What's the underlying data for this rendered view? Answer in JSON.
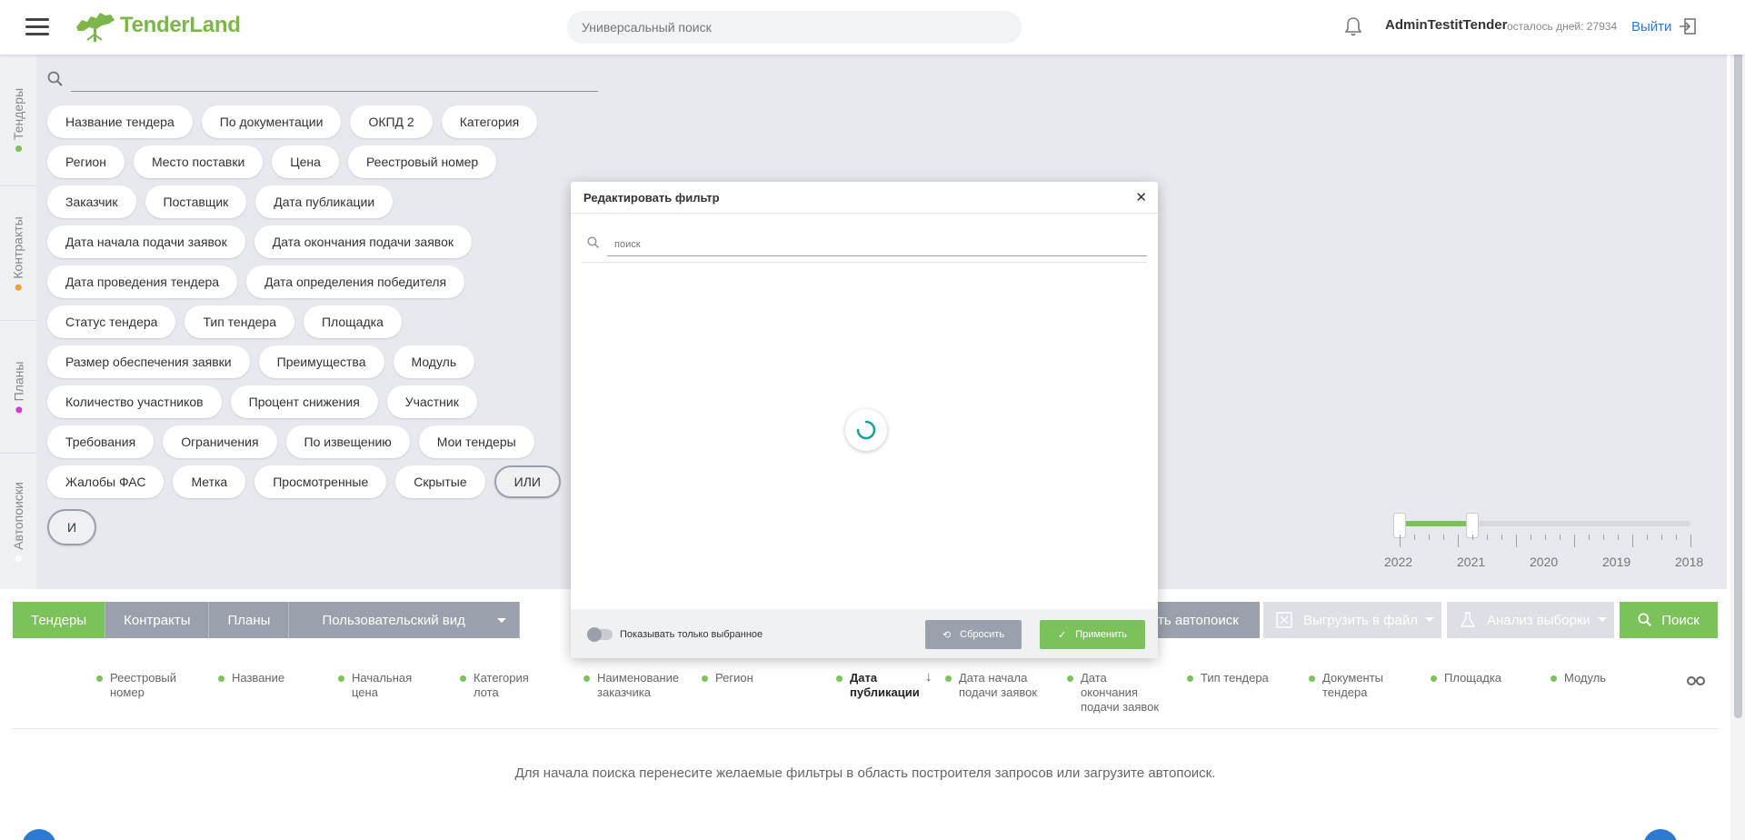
{
  "header": {
    "logo_text": "TenderLand",
    "search_placeholder": "Универсальный поиск",
    "user_name": "AdminTestitTender",
    "days_left": "осталось дней: 27934",
    "logout_label": "Выйти"
  },
  "side_tabs": [
    {
      "label": "Тендеры",
      "color": "#7cc25a"
    },
    {
      "label": "Контракты",
      "color": "#f0a030"
    },
    {
      "label": "Планы",
      "color": "#d63bd0"
    },
    {
      "label": "Автопоиски",
      "color": "#ffffff"
    }
  ],
  "filter_chips": [
    [
      "Название тендера",
      "По документации",
      "ОКПД 2",
      "Категория"
    ],
    [
      "Регион",
      "Место поставки",
      "Цена",
      "Реестровый номер"
    ],
    [
      "Заказчик",
      "Поставщик",
      "Дата публикации"
    ],
    [
      "Дата начала подачи заявок",
      "Дата окончания подачи заявок"
    ],
    [
      "Дата проведения тендера",
      "Дата определения победителя"
    ],
    [
      "Статус тендера",
      "Тип тендера",
      "Площадка"
    ],
    [
      "Размер обеспечения заявки",
      "Преимущества",
      "Модуль"
    ],
    [
      "Количество участников",
      "Процент снижения",
      "Участник"
    ],
    [
      "Требования",
      "Ограничения",
      "По извещению",
      "Мои тендеры"
    ],
    [
      "Жалобы ФАС",
      "Метка",
      "Просмотренные",
      "Скрытые",
      "ИЛИ"
    ],
    [
      "И"
    ]
  ],
  "year_slider": {
    "years": [
      "2022",
      "2021",
      "2020",
      "2019",
      "2018"
    ],
    "selected_range": [
      "2022",
      "2021"
    ]
  },
  "toolbar": {
    "tabs": [
      "Тендеры",
      "Контракты",
      "Планы"
    ],
    "view_label": "Пользовательский вид",
    "autosearch_label": "ть автопоиск",
    "export_label": "Выгрузить в файл",
    "analysis_label": "Анализ выборки",
    "search_label": "Поиск"
  },
  "columns": [
    {
      "label": "Реестровый номер",
      "lines": [
        "Реестровый",
        "номер"
      ]
    },
    {
      "label": "Название",
      "lines": [
        "Название"
      ]
    },
    {
      "label": "Начальная цена",
      "lines": [
        "Начальная",
        "цена"
      ]
    },
    {
      "label": "Категория лота",
      "lines": [
        "Категория",
        "лота"
      ]
    },
    {
      "label": "Наименование заказчика",
      "lines": [
        "Наименование",
        "заказчика"
      ]
    },
    {
      "label": "Регион",
      "lines": [
        "Регион"
      ]
    },
    {
      "label": "Дата публикации",
      "lines": [
        "Дата",
        "публикации"
      ],
      "sorted": true
    },
    {
      "label": "Дата начала подачи заявок",
      "lines": [
        "Дата начала",
        "подачи заявок"
      ]
    },
    {
      "label": "Дата окончания подачи заявок",
      "lines": [
        "Дата",
        "окончания",
        "подачи заявок"
      ]
    },
    {
      "label": "Тип тендера",
      "lines": [
        "Тип тендера"
      ]
    },
    {
      "label": "Документы тендера",
      "lines": [
        "Документы",
        "тендера"
      ]
    },
    {
      "label": "Площадка",
      "lines": [
        "Площадка"
      ]
    },
    {
      "label": "Модуль",
      "lines": [
        "Модуль"
      ]
    }
  ],
  "empty_message": "Для начала поиска перенесите желаемые фильтры в область построителя запросов или загрузите автопоиск.",
  "modal": {
    "title": "Редактировать фильтр",
    "search_placeholder": "поиск",
    "show_selected_label": "Показывать только выбранное",
    "reset_label": "Сбросить",
    "apply_label": "Применить"
  }
}
